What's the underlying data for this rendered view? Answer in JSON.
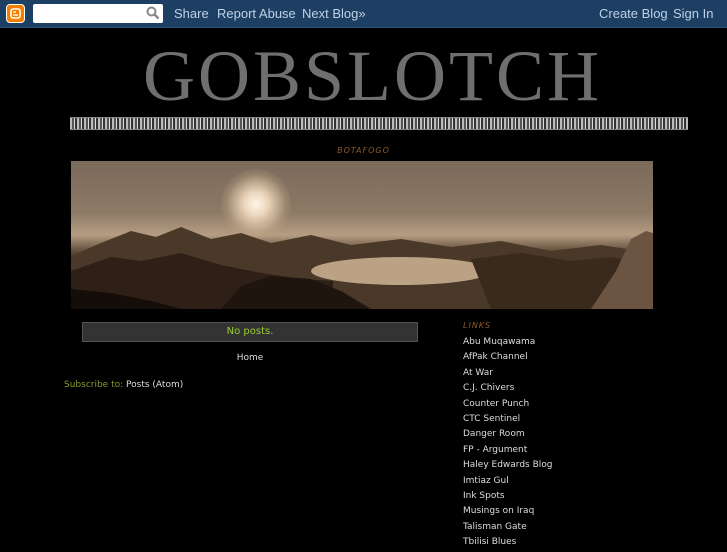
{
  "navbar": {
    "logo_icon": "blogger-logo-icon",
    "search_placeholder": "",
    "share": "Share",
    "report_abuse": "Report Abuse",
    "next_blog": "Next Blog»",
    "create_blog": "Create Blog",
    "sign_in": "Sign In"
  },
  "header": {
    "title": "GOBSLOTCH",
    "description": "BOTAFOGO"
  },
  "main": {
    "no_posts": "No posts.",
    "home": "Home",
    "subscribe_label": "Subscribe to:",
    "subscribe_feed": "Posts (Atom)"
  },
  "sidebar": {
    "title": "LINKS",
    "links": [
      "Abu Muqawama",
      "AfPak Channel",
      "At War",
      "C.J. Chivers",
      "Counter Punch",
      "CTC Sentinel",
      "Danger Room",
      "FP - Argument",
      "Haley Edwards Blog",
      "Imtiaz Gul",
      "Ink Spots",
      "Musings on Iraq",
      "Talisman Gate",
      "Tbilisi Blues"
    ]
  },
  "colors": {
    "navbar_bg": "#1e3f64",
    "page_bg": "#000000",
    "accent_brown": "#8b5a2b",
    "no_posts_green": "#9acd32",
    "blogger_orange": "#f57d00"
  }
}
